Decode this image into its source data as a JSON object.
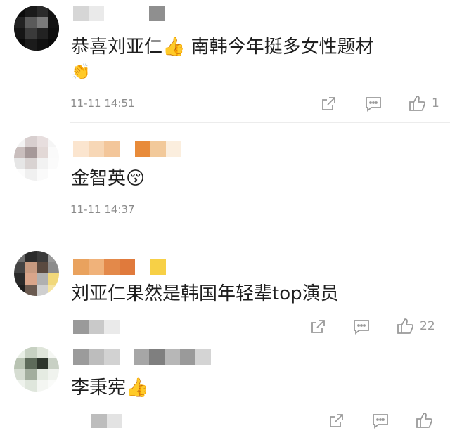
{
  "comments": [
    {
      "text": "恭喜刘亚仁👍 南韩今年挺多女性题材",
      "emoji_line": "👏",
      "time": "11-11 14:51",
      "like_count": "1"
    },
    {
      "text": "金智英😚",
      "time": "11-11 14:37"
    },
    {
      "text": "刘亚仁果然是韩国年轻辈top演员",
      "like_count": "22"
    },
    {
      "text": "李秉宪👍"
    }
  ],
  "icons": {
    "share": "share-icon",
    "reply": "comment-icon",
    "like": "thumbs-up-icon"
  },
  "colors": {
    "text": "#1f1f1f",
    "meta": "#8a8a8a",
    "icon": "#9a9a9a"
  }
}
